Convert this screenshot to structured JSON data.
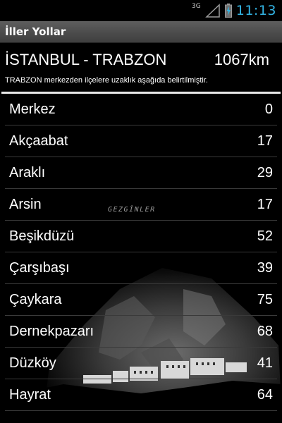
{
  "status": {
    "network": "3G",
    "time": "11:13"
  },
  "app": {
    "title": "İller Yollar"
  },
  "route": {
    "name": "İSTANBUL - TRABZON",
    "distance": "1067km",
    "subtitle": "TRABZON merkezden ilçelere uzaklık aşağıda belirtilmiştir."
  },
  "districts": [
    {
      "name": "Merkez",
      "km": "0"
    },
    {
      "name": "Akçaabat",
      "km": "17"
    },
    {
      "name": "Araklı",
      "km": "29"
    },
    {
      "name": "Arsin",
      "km": "17"
    },
    {
      "name": "Beşikdüzü",
      "km": "52"
    },
    {
      "name": "Çarşıbaşı",
      "km": "39"
    },
    {
      "name": "Çaykara",
      "km": "75"
    },
    {
      "name": "Dernekpazarı",
      "km": "68"
    },
    {
      "name": "Düzköy",
      "km": "41"
    },
    {
      "name": "Hayrat",
      "km": "64"
    }
  ],
  "watermark": "GEZGİNLER"
}
